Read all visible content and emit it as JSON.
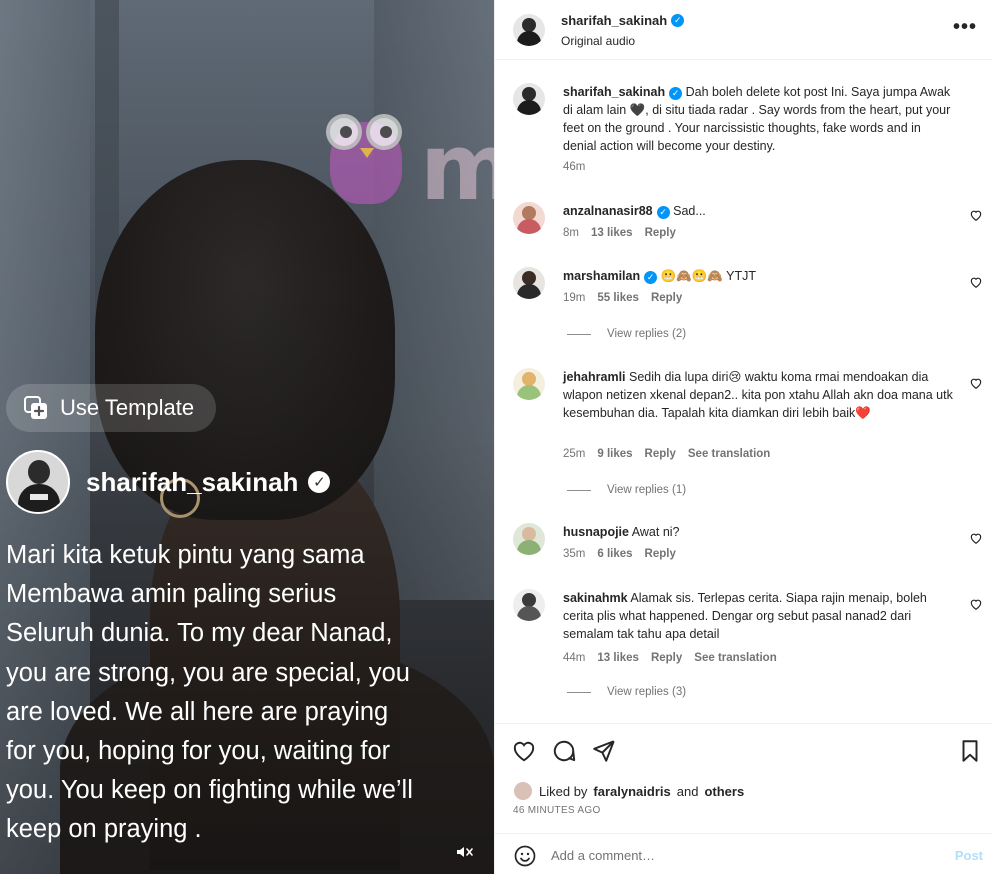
{
  "media": {
    "watermark_text": "murai",
    "use_template_label": "Use Template",
    "owner_username": "sharifah_sakinah",
    "caption": "Mari kita ketuk pintu yang sama\nMembawa amin paling serius\nSeluruh dunia. To my dear Nanad,\nyou are strong, you are special, you\nare loved. We  all here are praying\nfor you, hoping for you, waiting for\nyou. You keep on fighting while we’ll\nkeep on praying ."
  },
  "header": {
    "username": "sharifah_sakinah",
    "subtitle": "Original audio",
    "more_label": "•••"
  },
  "post_caption": {
    "username": "sharifah_sakinah",
    "text": "Dah boleh delete kot post Ini. Saya jumpa Awak di alam lain 🖤, di situ tiada radar . Say words from the heart, put your feet on the ground . Your narcissistic thoughts, fake words and in denial action will become your destiny.",
    "time": "46m"
  },
  "comments": [
    {
      "username": "anzalnanasir88",
      "verified": true,
      "text": "Sad...",
      "time": "8m",
      "likes": "13 likes",
      "reply": "Reply"
    },
    {
      "username": "marshamilan",
      "verified": true,
      "text": "😬🙈😬🙈 YTJT",
      "time": "19m",
      "likes": "55 likes",
      "reply": "Reply",
      "view_replies": "View replies (2)"
    },
    {
      "username": "jehahramli",
      "verified": false,
      "text": "Sedih dia lupa diri😢 waktu koma rmai mendoakan dia wlapon netizen xkenal depan2.. kita pon xtahu Allah akn doa mana utk kesembuhan dia. Tapalah kita diamkan diri lebih baik❤️",
      "time": "25m",
      "likes": "9 likes",
      "reply": "Reply",
      "translate": "See translation",
      "view_replies": "View replies (1)"
    },
    {
      "username": "husnapojie",
      "verified": false,
      "text": "Awat ni?",
      "time": "35m",
      "likes": "6 likes",
      "reply": "Reply"
    },
    {
      "username": "sakinahmk",
      "verified": false,
      "text": "Alamak sis. Terlepas cerita. Siapa rajin menaip, boleh cerita plis what happened. Dengar org sebut pasal nanad2 dari semalam tak tahu apa detail",
      "time": "44m",
      "likes": "13 likes",
      "reply": "Reply",
      "translate": "See translation",
      "view_replies": "View replies (3)"
    }
  ],
  "likes": {
    "prefix": "Liked by",
    "user": "faralynaidris",
    "and": "and",
    "others": "others",
    "time_ago": "46 MINUTES AGO"
  },
  "add_comment": {
    "placeholder": "Add a comment…",
    "post_label": "Post"
  },
  "colors": {
    "verified": "#0095f6",
    "post_disabled": "#b2dffc",
    "muted_text": "#737373"
  }
}
